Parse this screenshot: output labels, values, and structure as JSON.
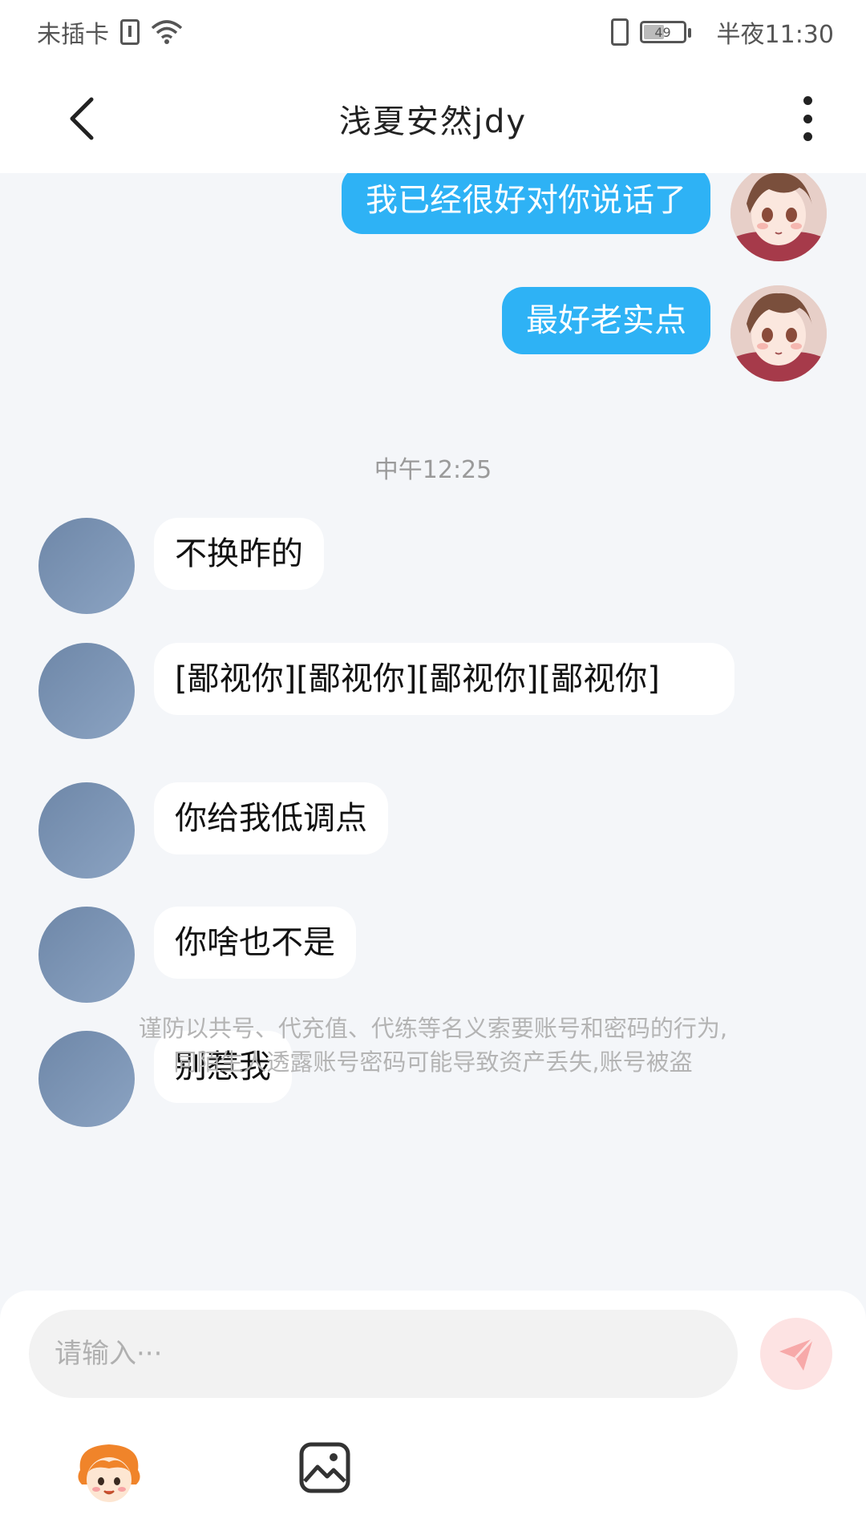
{
  "status_bar": {
    "carrier": "未插卡",
    "battery_level": "49",
    "time": "半夜11:30"
  },
  "header": {
    "title": "浅夏安然jdy"
  },
  "messages_out": [
    {
      "text": "我已经很好对你说话了"
    },
    {
      "text": "最好老实点"
    }
  ],
  "timestamp": "中午12:25",
  "messages_in": [
    {
      "text": "不换昨的"
    },
    {
      "text": "[鄙视你][鄙视你][鄙视你][鄙视你]"
    },
    {
      "text": "你给我低调点"
    },
    {
      "text": "你啥也不是"
    },
    {
      "text": "别惹我"
    }
  ],
  "warning": {
    "line1": "谨防以共号、代充值、代练等名义索要账号和密码的行为,",
    "line2": "同陌生人透露账号密码可能导致资产丢失,账号被盗"
  },
  "input": {
    "placeholder": "请输入···"
  },
  "colors": {
    "outgoing_bubble": "#2eb2f5",
    "send_button": "#fde3e3",
    "send_icon": "#f7a9a9"
  },
  "icons": [
    "back-arrow-icon",
    "more-vertical-icon",
    "send-icon",
    "emoji-avatar-icon",
    "image-icon",
    "wifi-icon",
    "sim-icon",
    "vibrate-icon",
    "battery-icon"
  ]
}
